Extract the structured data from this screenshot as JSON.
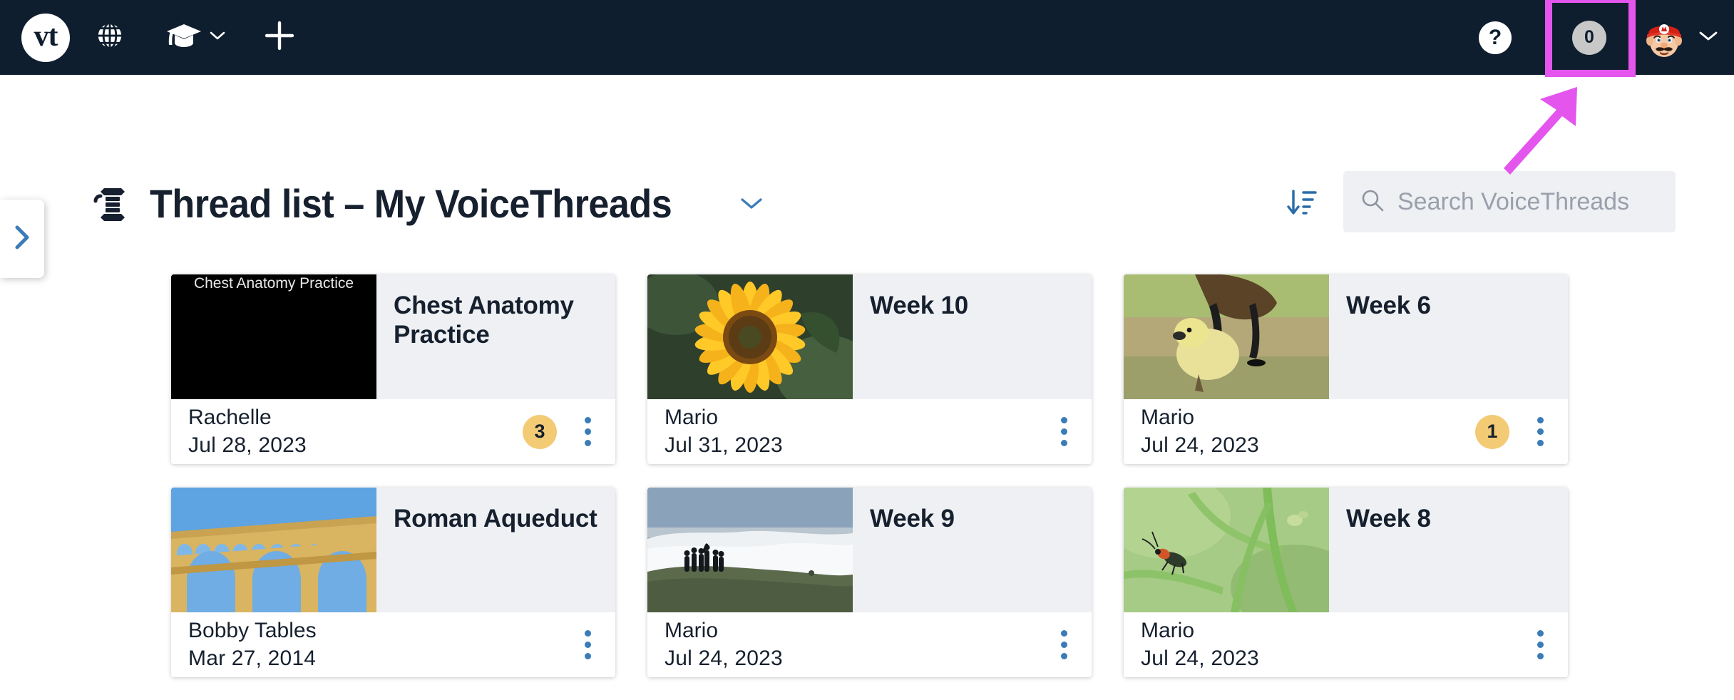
{
  "topbar": {
    "logo_text": "vt",
    "logo_name": "voicethread-logo",
    "globe_icon": "globe-icon",
    "graduation_icon": "graduation-cap-icon",
    "graduation_caret": "chevron-down-icon",
    "plus_icon": "plus-icon",
    "help_label": "?",
    "notification_count": "0",
    "avatar_name": "mario-avatar",
    "avatar_caret": "chevron-down-icon"
  },
  "annotation": {
    "highlight_color": "#e455ee",
    "target": "notification-count-badge"
  },
  "sidebar": {
    "toggle_icon": "chevron-right-icon"
  },
  "page": {
    "icon": "thread-spool-icon",
    "title": "Thread list – My VoiceThreads",
    "title_caret": "chevron-down-icon"
  },
  "toolbar": {
    "sort_icon": "sort-descending-icon",
    "search_placeholder": "Search VoiceThreads",
    "search_value": "",
    "search_icon": "search-icon"
  },
  "colors": {
    "topbar_bg": "#0f1e2e",
    "accent_blue": "#3a7cb8",
    "badge_amber": "#f3cb74",
    "card_title_bg": "#eef0f3",
    "highlight_magenta": "#e455ee"
  },
  "cards": [
    {
      "title": "Chest Anatomy Practice",
      "author": "Rachelle",
      "date": "Jul 28, 2023",
      "count": "3",
      "thumb_type": "text",
      "thumb_text": "Chest Anatomy Practice",
      "thumb_name": "thumbnail-chest-anatomy-practice"
    },
    {
      "title": "Week 10",
      "author": "Mario",
      "date": "Jul 31, 2023",
      "count": "",
      "thumb_type": "sunflower",
      "thumb_text": "",
      "thumb_name": "thumbnail-sunflower"
    },
    {
      "title": "Week 6",
      "author": "Mario",
      "date": "Jul 24, 2023",
      "count": "1",
      "thumb_type": "gosling",
      "thumb_text": "",
      "thumb_name": "thumbnail-gosling"
    },
    {
      "title": "Roman Aqueduct",
      "author": "Bobby Tables",
      "date": "Mar 27, 2014",
      "count": "",
      "thumb_type": "aqueduct",
      "thumb_text": "",
      "thumb_name": "thumbnail-roman-aqueduct"
    },
    {
      "title": "Week 9",
      "author": "Mario",
      "date": "Jul 24, 2023",
      "count": "",
      "thumb_type": "cloudscape",
      "thumb_text": "",
      "thumb_name": "thumbnail-cloudscape"
    },
    {
      "title": "Week 8",
      "author": "Mario",
      "date": "Jul 24, 2023",
      "count": "",
      "thumb_type": "beetle",
      "thumb_text": "",
      "thumb_name": "thumbnail-beetle"
    }
  ]
}
